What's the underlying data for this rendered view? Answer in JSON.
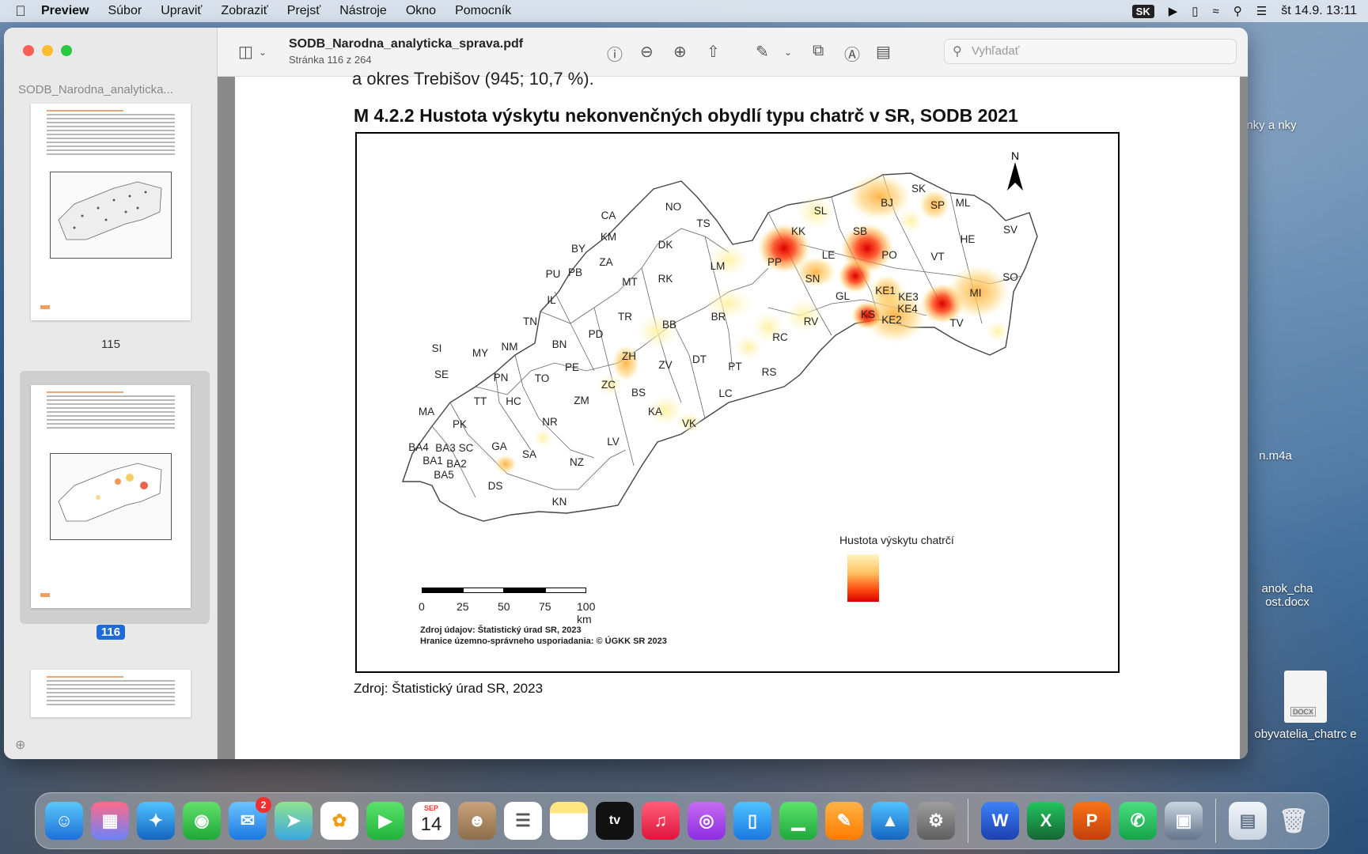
{
  "menubar": {
    "app": "Preview",
    "items": [
      "Súbor",
      "Upraviť",
      "Zobraziť",
      "Prejsť",
      "Nástroje",
      "Okno",
      "Pomocník"
    ],
    "input_source": "SK",
    "datetime": "št 14.9.  13:11"
  },
  "window": {
    "doc_title": "SODB_Narodna_analyticka_sprava.pdf",
    "doc_subtitle": "Stránka 116 z 264",
    "search_placeholder": "Vyhľadať"
  },
  "sidebar": {
    "title": "SODB_Narodna_analyticka...",
    "pages": [
      "115",
      "116"
    ]
  },
  "page": {
    "cut_text": "a okres Trebišov (945; 10,7 %).",
    "figure_title": "M 4.2.2 Hustota výskytu nekonvenčných obydlí typu chatrč v SR, SODB 2021",
    "north": "N",
    "legend_title": "Hustota výskytu chatrčí",
    "scale_labels": [
      "0",
      "25",
      "50",
      "75",
      "100 km"
    ],
    "credit1": "Zdroj údajov: Štatistický úrad SR, 2023",
    "credit2": "Hranice územno-správneho usporiadania: © ÚGKK SR 2023",
    "source": "Zdroj: Štatistický úrad SR, 2023",
    "district_labels": [
      "NO",
      "TS",
      "CA",
      "KM",
      "DK",
      "BY",
      "ZA",
      "PU",
      "PB",
      "MT",
      "RK",
      "LM",
      "KK",
      "SL",
      "BJ",
      "SK",
      "SP",
      "ML",
      "SB",
      "HE",
      "SV",
      "PP",
      "LE",
      "PO",
      "VT",
      "SN",
      "KE1",
      "KE3",
      "KE4",
      "KE2",
      "MI",
      "SO",
      "GL",
      "KS",
      "TV",
      "RV",
      "RC",
      "IL",
      "TN",
      "TR",
      "BB",
      "BR",
      "PD",
      "BN",
      "NM",
      "MY",
      "SI",
      "SE",
      "PN",
      "TO",
      "PE",
      "ZH",
      "ZV",
      "DT",
      "PT",
      "RS",
      "ZC",
      "BS",
      "LC",
      "HC",
      "TT",
      "ZM",
      "KA",
      "VK",
      "MA",
      "PK",
      "NR",
      "BA4",
      "BA3",
      "SC",
      "GA",
      "BA1",
      "BA2",
      "BA5",
      "SA",
      "LV",
      "NZ",
      "DS",
      "KN"
    ]
  },
  "desktop": {
    "items": [
      "nky a nky",
      "n.m4a",
      "anok_cha ost.docx",
      "obyvatelia_chatrc e"
    ]
  },
  "dock": {
    "calendar_month": "SEP",
    "calendar_day": "14",
    "mail_badge": "2",
    "tv_label": "tv"
  }
}
